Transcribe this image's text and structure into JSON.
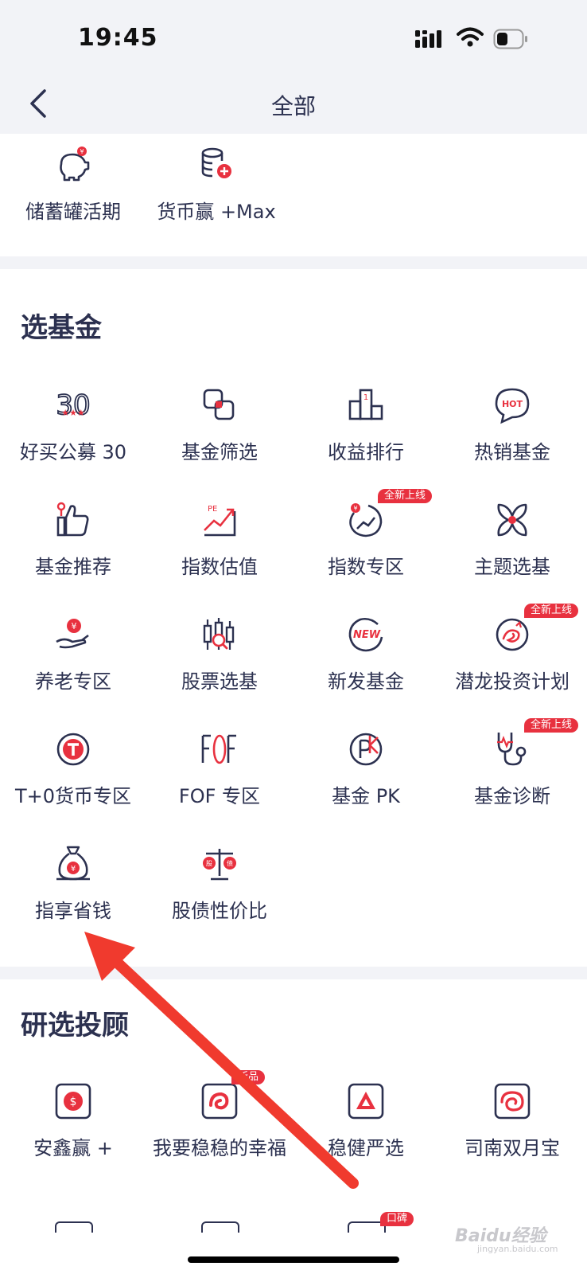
{
  "status": {
    "time": "19:45"
  },
  "nav": {
    "title": "全部"
  },
  "section1": {
    "items": [
      {
        "label": "储蓄罐活期",
        "icon": "piggy-bank-icon"
      },
      {
        "label": "货币赢 +Max",
        "icon": "coins-plus-icon"
      }
    ]
  },
  "section2": {
    "title": "选基金",
    "items": [
      {
        "label": "好买公募 30",
        "icon": "number-30-icon"
      },
      {
        "label": "基金筛选",
        "icon": "filter-squares-icon"
      },
      {
        "label": "收益排行",
        "icon": "podium-icon"
      },
      {
        "label": "热销基金",
        "icon": "hot-bubble-icon"
      },
      {
        "label": "基金推荐",
        "icon": "thumbs-up-icon"
      },
      {
        "label": "指数估值",
        "icon": "pe-chart-icon"
      },
      {
        "label": "指数专区",
        "icon": "index-gauge-icon",
        "badge": "全新上线"
      },
      {
        "label": "主题选基",
        "icon": "flower-icon"
      },
      {
        "label": "养老专区",
        "icon": "hand-coin-icon"
      },
      {
        "label": "股票选基",
        "icon": "candlestick-search-icon"
      },
      {
        "label": "新发基金",
        "icon": "new-circle-icon"
      },
      {
        "label": "潜龙投资计划",
        "icon": "dragon-icon",
        "badge": "全新上线"
      },
      {
        "label": "T+0货币专区",
        "icon": "t-circle-icon"
      },
      {
        "label": "FOF 专区",
        "icon": "fof-icon"
      },
      {
        "label": "基金 PK",
        "icon": "pk-circle-icon"
      },
      {
        "label": "基金诊断",
        "icon": "stethoscope-icon",
        "badge": "全新上线"
      },
      {
        "label": "指享省钱",
        "icon": "money-bag-icon"
      },
      {
        "label": "股债性价比",
        "icon": "balance-scale-icon"
      }
    ],
    "scale_left": "股",
    "scale_right": "债"
  },
  "section3": {
    "title": "研选投顾",
    "items": [
      {
        "label": "安鑫赢 +",
        "icon": "dollar-square-icon"
      },
      {
        "label": "我要稳稳的幸福",
        "icon": "swirl-square-icon",
        "badge": "新品"
      },
      {
        "label": "稳健严选",
        "icon": "triangle-square-icon"
      },
      {
        "label": "司南双月宝",
        "icon": "spiral-square-icon"
      }
    ],
    "next_badge": "口碑"
  },
  "watermark": {
    "brand": "Baidu经验",
    "url": "jingyan.baidu.com"
  },
  "colors": {
    "accent": "#e8313f",
    "navy": "#2c3150",
    "bg": "#f2f3f7"
  }
}
